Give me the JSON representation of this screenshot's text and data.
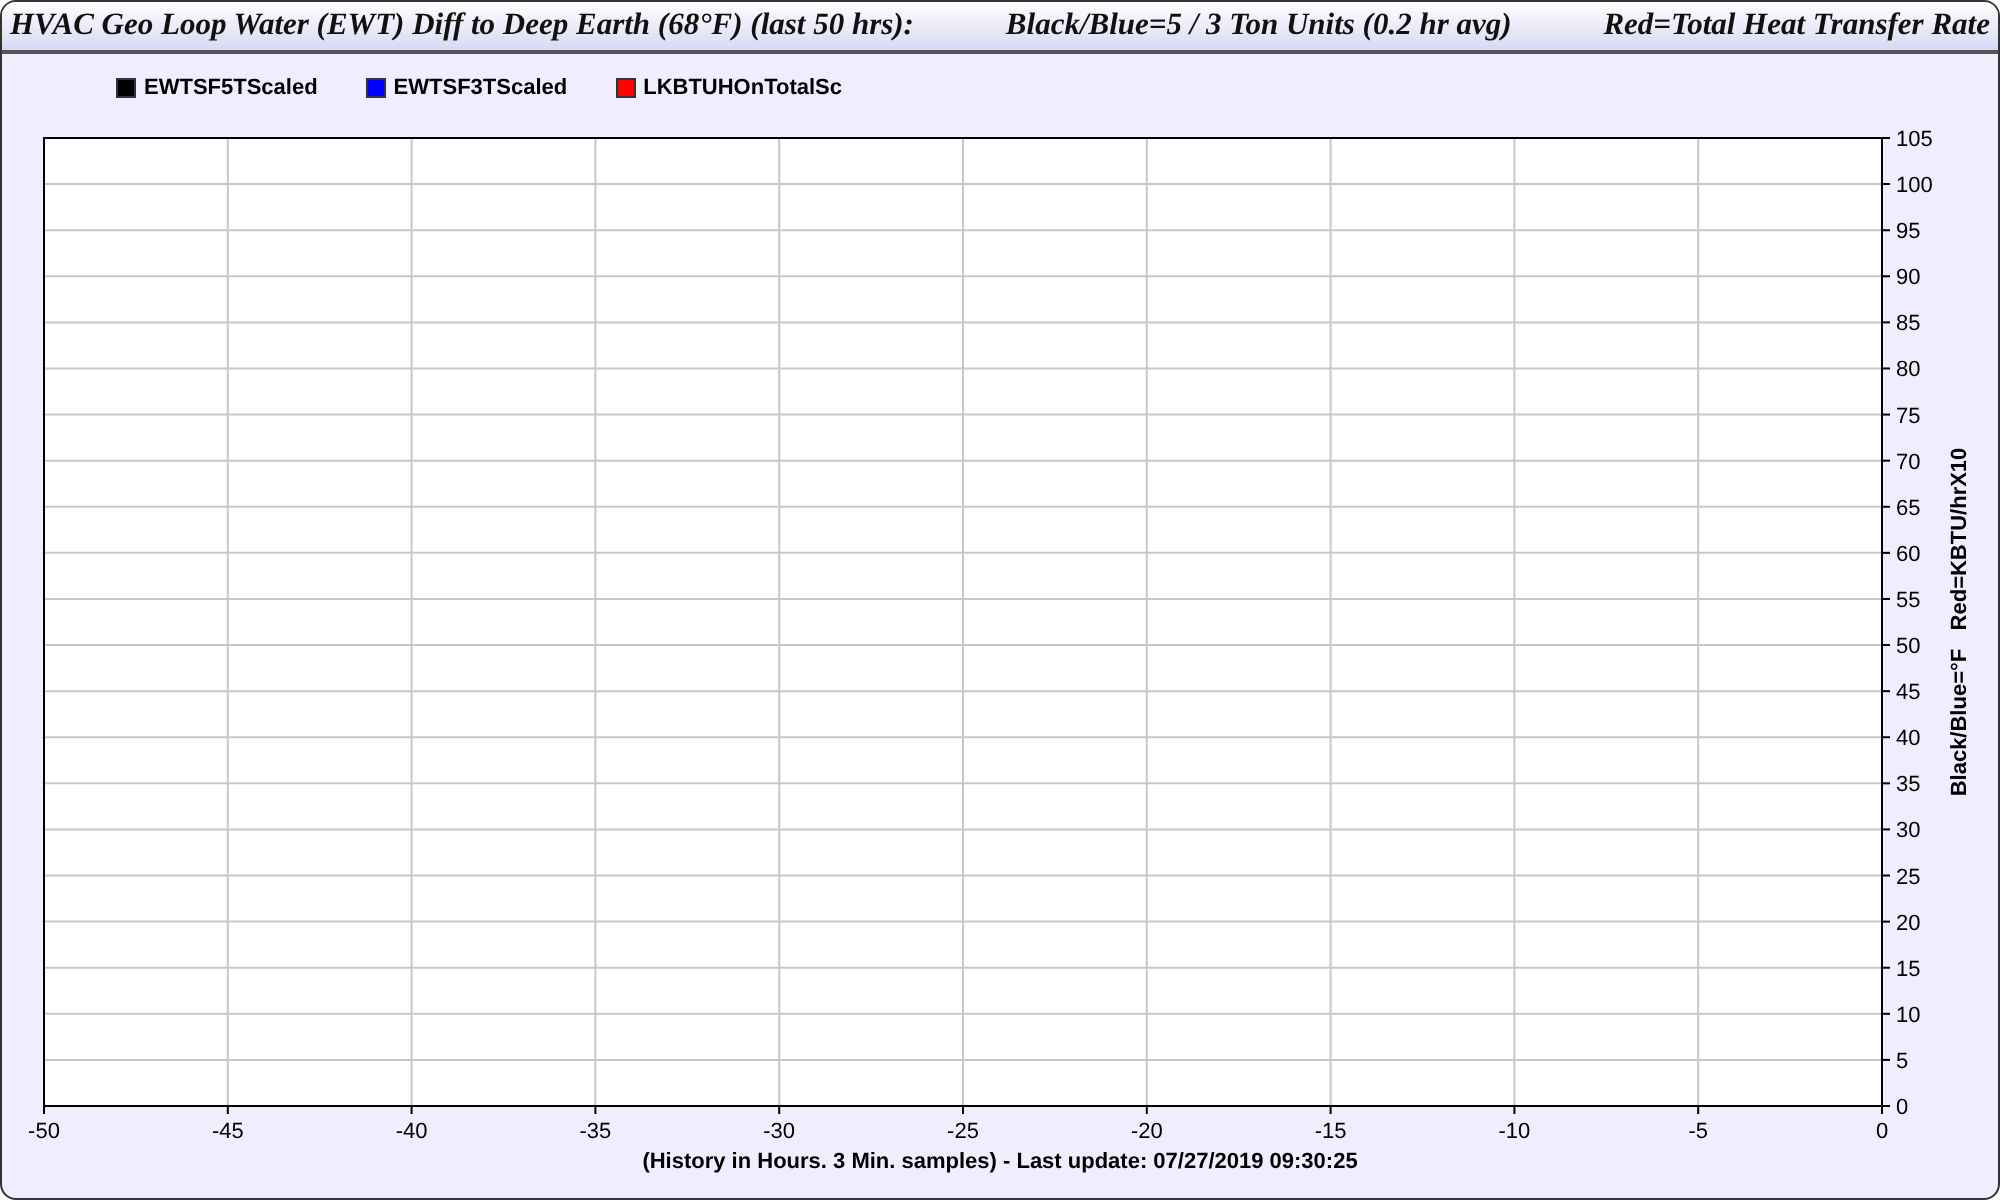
{
  "window": {
    "title_segments": [
      "HVAC Geo Loop Water (EWT) Diff to Deep Earth (68°F) (last 50 hrs):",
      "Black/Blue=5 / 3 Ton Units (0.2 hr avg)",
      "Red=Total Heat Transfer Rate"
    ]
  },
  "chart": {
    "chart_data": {
      "type": "line",
      "grid": true,
      "ylabel": "Black/Blue=°F   Red=KBTU/hrX10",
      "ylim": [
        0,
        105
      ],
      "categories": [
        "-50",
        "-45",
        "-40",
        "-35",
        "-30",
        "-25",
        "-20",
        "-15",
        "-10",
        "-5",
        "0"
      ],
      "yticks": [
        0,
        5,
        10,
        15,
        20,
        25,
        30,
        35,
        40,
        45,
        50,
        55,
        60,
        65,
        70,
        75,
        80,
        85,
        90,
        95,
        100,
        105
      ],
      "series": [
        {
          "name": "EWTSF5TScaled",
          "color": "#000000",
          "values": [
            null,
            null,
            null,
            null,
            null,
            null,
            null,
            null,
            null,
            null,
            null
          ]
        },
        {
          "name": "EWTSF3TScaled",
          "color": "#0000ff",
          "values": [
            null,
            null,
            null,
            null,
            null,
            null,
            null,
            null,
            null,
            null,
            null
          ]
        },
        {
          "name": "LKBTUHOnTotalSc",
          "color": "#ff0000",
          "values": [
            null,
            null,
            null,
            null,
            null,
            null,
            null,
            null,
            null,
            null,
            null
          ]
        }
      ]
    },
    "footer": "(History in Hours. 3 Min. samples) - Last update: 07/27/2019 09:30:25"
  }
}
